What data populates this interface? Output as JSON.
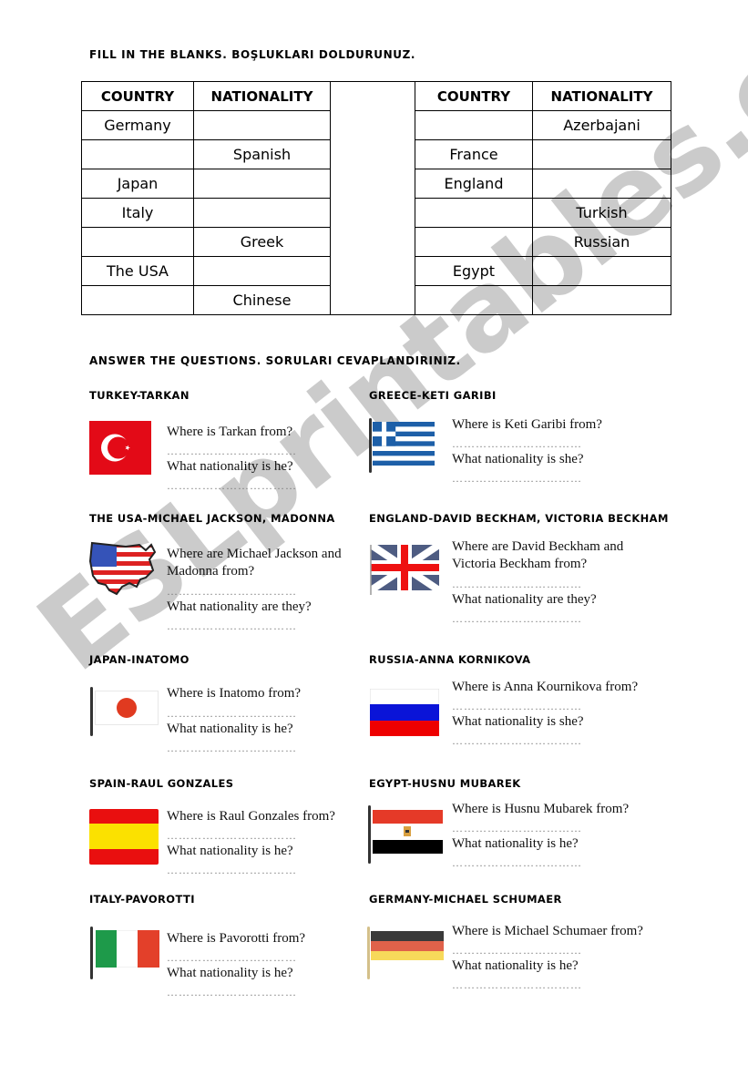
{
  "section1": {
    "heading": "FILL IN THE BLANKS. BOŞLUKLARI DOLDURUNUZ.",
    "headers": [
      "COUNTRY",
      "NATIONALITY",
      "",
      "COUNTRY",
      "NATIONALITY"
    ],
    "left_rows": [
      [
        "Germany",
        ""
      ],
      [
        "",
        "Spanish"
      ],
      [
        "Japan",
        ""
      ],
      [
        "Italy",
        ""
      ],
      [
        "",
        "Greek"
      ],
      [
        "The USA",
        ""
      ],
      [
        "",
        "Chinese"
      ]
    ],
    "right_rows": [
      [
        "",
        "Azerbajani"
      ],
      [
        "France",
        ""
      ],
      [
        "England",
        ""
      ],
      [
        "",
        "Turkish"
      ],
      [
        "",
        "Russian"
      ],
      [
        "Egypt",
        ""
      ],
      [
        "",
        ""
      ]
    ]
  },
  "section2": {
    "heading": "ANSWER THE QUESTIONS. SORULARI CEVAPLANDIRINIZ.",
    "answer_blank": "……………………………",
    "cards": [
      {
        "title": "TURKEY-TARKAN",
        "flag": "turkey-flag",
        "q1": "Where is Tarkan from?",
        "q2": "What nationality is he?"
      },
      {
        "title": "GREECE-KETI GARIBI",
        "flag": "greece-flag",
        "q1": "Where is Keti Garibi from?",
        "q2": "What nationality is she?"
      },
      {
        "title": "THE USA-MICHAEL JACKSON, MADONNA",
        "flag": "usa-map-flag",
        "q1": "Where are Michael Jackson and Madonna from?",
        "q2": "What nationality are they?"
      },
      {
        "title": "ENGLAND-DAVID BECKHAM, VICTORIA BECKHAM",
        "flag": "uk-flag",
        "q1": "Where are David Beckham and Victoria Beckham from?",
        "q2": "What nationality are they?"
      },
      {
        "title": "JAPAN-INATOMO",
        "flag": "japan-flag",
        "q1": "Where is Inatomo from?",
        "q2": "What nationality is he?"
      },
      {
        "title": "RUSSIA-ANNA KORNIKOVA",
        "flag": "russia-flag",
        "q1": "Where is Anna Kournikova from?",
        "q2": "What nationality is she?"
      },
      {
        "title": "SPAIN-RAUL GONZALES",
        "flag": "spain-flag",
        "q1": "Where is Raul Gonzales from?",
        "q2": "What nationality is he?"
      },
      {
        "title": "EGYPT-HUSNU MUBAREK",
        "flag": "egypt-flag",
        "q1": "Where is Husnu Mubarek from?",
        "q2": "What nationality is he?"
      },
      {
        "title": "ITALY-PAVOROTTI",
        "flag": "italy-flag",
        "q1": "Where is Pavorotti from?",
        "q2": "What nationality is he?"
      },
      {
        "title": "GERMANY-MICHAEL SCHUMAER",
        "flag": "germany-flag",
        "q1": "Where is Michael Schumaer from?",
        "q2": "What nationality is he?"
      }
    ]
  },
  "watermark": "ESLprintables.com"
}
